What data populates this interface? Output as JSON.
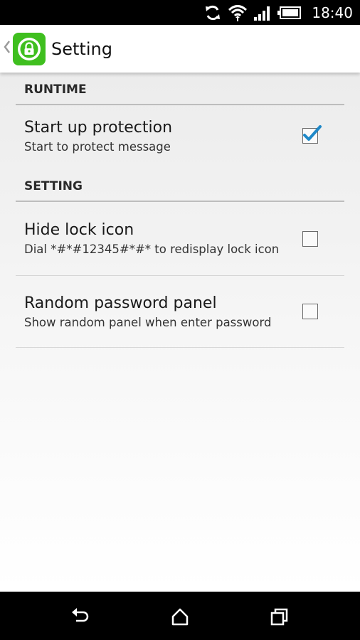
{
  "status_bar": {
    "time": "18:40",
    "icons": [
      "sync-icon",
      "wifi-icon",
      "signal-icon",
      "battery-icon"
    ]
  },
  "action_bar": {
    "back_icon": "chevron-left-icon",
    "app_icon": "lock-app-icon",
    "title": "Setting"
  },
  "sections": [
    {
      "header": "RUNTIME",
      "items": [
        {
          "title": "Start up protection",
          "summary": "Start to protect message",
          "checked": true
        }
      ]
    },
    {
      "header": "SETTING",
      "items": [
        {
          "title": "Hide lock icon",
          "summary": "Dial *#*#12345#*#* to redisplay lock icon",
          "checked": false
        },
        {
          "title": "Random password panel",
          "summary": "Show random panel when enter password",
          "checked": false
        }
      ]
    }
  ],
  "nav_bar": {
    "icons": [
      "back-icon",
      "home-icon",
      "recent-apps-icon"
    ]
  },
  "colors": {
    "accent": "#3fbf1f",
    "checkmark": "#1e88c8"
  }
}
